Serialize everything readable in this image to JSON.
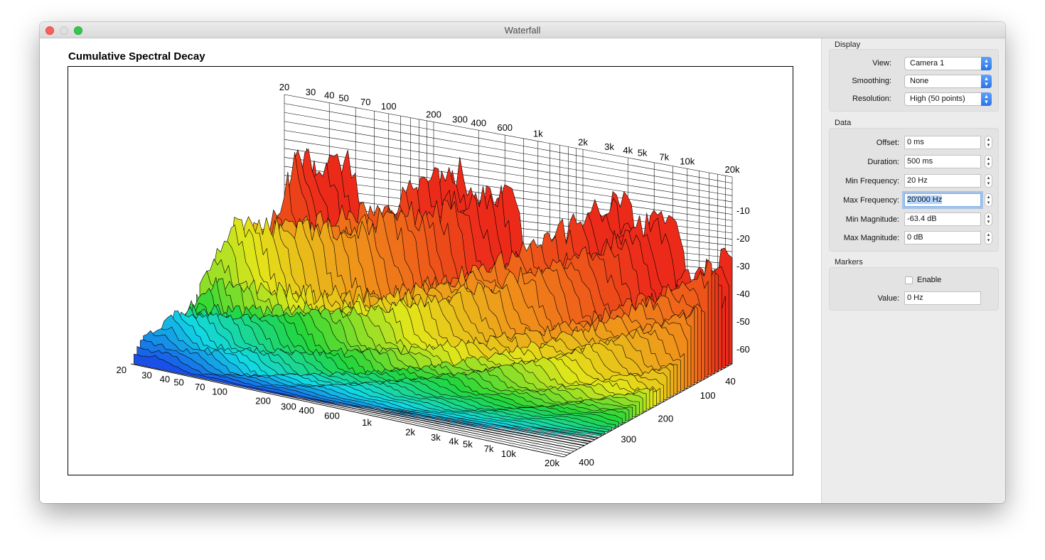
{
  "window": {
    "title": "Waterfall"
  },
  "chart_data": {
    "type": "3d-waterfall",
    "title": "Cumulative Spectral Decay",
    "frequency_ticks": [
      "20",
      "30",
      "40",
      "50",
      "70",
      "100",
      "200",
      "300",
      "400",
      "600",
      "1k",
      "2k",
      "3k",
      "4k",
      "5k",
      "7k",
      "10k",
      "20k"
    ],
    "magnitude_ticks": [
      "-10",
      "-20",
      "-30",
      "-40",
      "-50",
      "-60"
    ],
    "time_ticks": [
      "40",
      "100",
      "200",
      "300",
      "400"
    ],
    "num_slices": 50,
    "color_map": [
      "#1a36e8",
      "#12d8e6",
      "#22d63a",
      "#e3e61a",
      "#f08a1a",
      "#ec2a1a"
    ]
  },
  "sidebar": {
    "display": {
      "title": "Display",
      "view": {
        "label": "View:",
        "value": "Camera 1"
      },
      "smoothing": {
        "label": "Smoothing:",
        "value": "None"
      },
      "resolution": {
        "label": "Resolution:",
        "value": "High (50 points)"
      }
    },
    "data": {
      "title": "Data",
      "offset": {
        "label": "Offset:",
        "value": "0 ms"
      },
      "duration": {
        "label": "Duration:",
        "value": "500 ms"
      },
      "min_frequency": {
        "label": "Min Frequency:",
        "value": "20 Hz"
      },
      "max_frequency": {
        "label": "Max Frequency:",
        "value": "20'000 Hz"
      },
      "min_magnitude": {
        "label": "Min Magnitude:",
        "value": "-63.4 dB"
      },
      "max_magnitude": {
        "label": "Max Magnitude:",
        "value": "0 dB"
      }
    },
    "markers": {
      "title": "Markers",
      "enable_label": "Enable",
      "value": {
        "label": "Value:",
        "value": "0 Hz"
      }
    }
  }
}
